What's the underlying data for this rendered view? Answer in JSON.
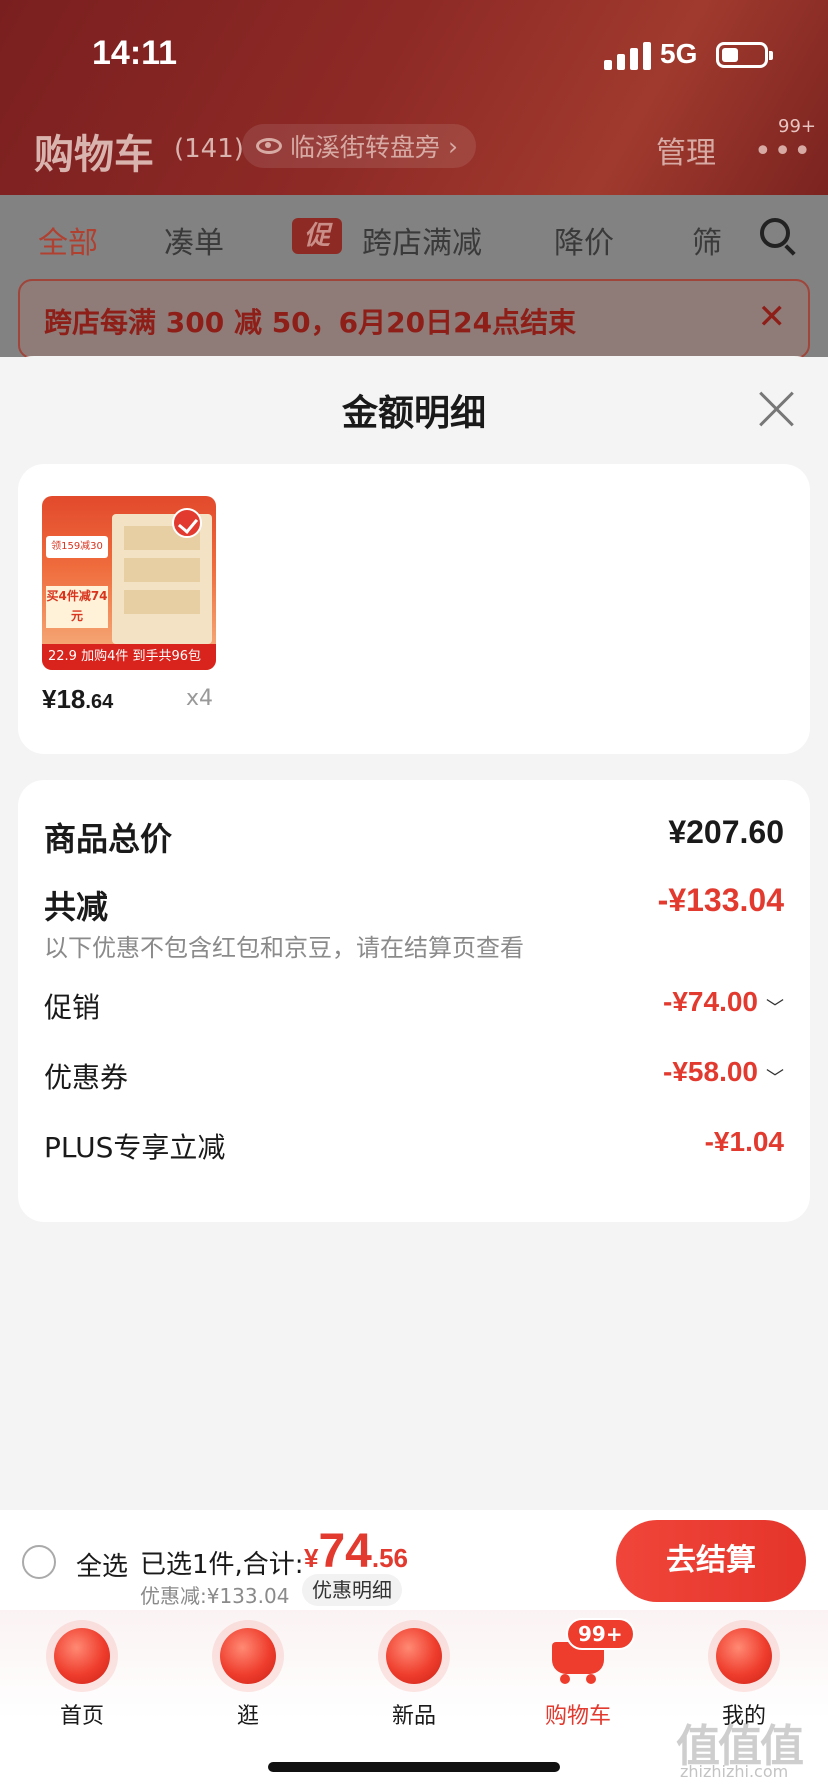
{
  "status_bar": {
    "time": "14:11",
    "network": "5G"
  },
  "header": {
    "title": "购物车",
    "count": "(141)",
    "location": "临溪街转盘旁",
    "manage": "管理",
    "more_badge": "99+"
  },
  "tabs": [
    {
      "label": "全部",
      "active": true
    },
    {
      "label": "凑单"
    },
    {
      "label": "跨店满减",
      "mark": "促"
    },
    {
      "label": "降价"
    },
    {
      "label": "筛"
    }
  ],
  "notice": {
    "text": "跨店每满 300 减 50，6月20日24点结束"
  },
  "sheet": {
    "title": "金额明细",
    "product": {
      "thumb_tags": {
        "tag1": "领159减30",
        "tag2": "买4件减74元",
        "price": "22.9 加购4件 到手共96包"
      },
      "price_big": "¥18",
      "price_small": ".64",
      "qty": "x4"
    },
    "summary": {
      "total_label": "商品总价",
      "total_amount": "¥207.60",
      "reduce_label": "共减",
      "reduce_amount": "-¥133.04",
      "note": "以下优惠不包含红包和京豆，请在结算页查看",
      "items": [
        {
          "label": "促销",
          "amount": "-¥74.00",
          "chevron": "﹀"
        },
        {
          "label": "优惠券",
          "amount": "-¥58.00",
          "chevron": "﹀"
        },
        {
          "label": "PLUS专享立减",
          "amount": "-¥1.04"
        }
      ]
    }
  },
  "checkout": {
    "select_all": "全选",
    "selected": "已选1件,合计:",
    "yen": "¥",
    "total_big": "74",
    "total_small": ".56",
    "discount": "优惠减:¥133.04",
    "detail_link": "优惠明细",
    "button": "去结算"
  },
  "tabbar": {
    "items": [
      {
        "label": "首页",
        "icon": "home-icon"
      },
      {
        "label": "逛",
        "icon": "browse-icon"
      },
      {
        "label": "新品",
        "icon": "new-icon"
      },
      {
        "label": "购物车",
        "icon": "cart-icon",
        "active": true
      },
      {
        "label": "我的",
        "icon": "profile-icon"
      }
    ],
    "cart_badge": "99+"
  },
  "watermark": {
    "main": "值值值",
    "sub": "zhizhizhi.com"
  },
  "colors": {
    "accent": "#e23a2f",
    "header_bg": "#8e2a26"
  }
}
